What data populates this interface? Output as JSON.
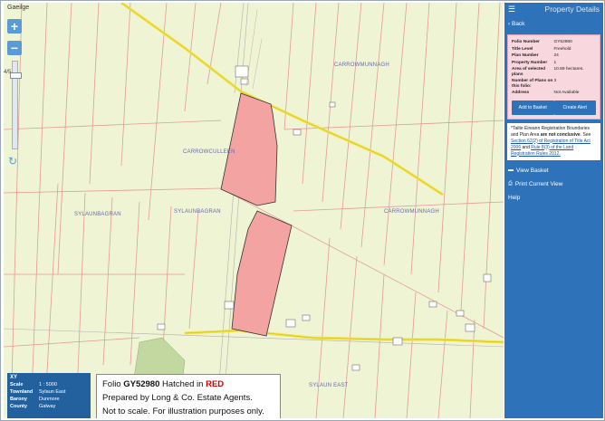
{
  "map": {
    "language_toggle": "Gaeilge",
    "zoom_in": "+",
    "zoom_out": "−",
    "zoom_level_label": "4/5",
    "refresh_icon": "↻",
    "labels": [
      {
        "text": "CARROWMUNNAGH",
        "slot": "a"
      },
      {
        "text": "CARROWCULLEEN",
        "slot": "b"
      },
      {
        "text": "SYLAUNBAGRAN",
        "slot": "c"
      },
      {
        "text": "SYLAUNBAGRAN",
        "slot": "d"
      },
      {
        "text": "CARROWMUNNAGH",
        "slot": "e"
      },
      {
        "text": "SYLAUN EAST",
        "slot": "f"
      }
    ],
    "highlight_color": "#f4a3a3",
    "road_color": "#f2e24a",
    "boundary_color": "#e08080"
  },
  "xy_panel": {
    "title": "XY",
    "rows": [
      {
        "key": "Scale",
        "value": "1 : 5000"
      },
      {
        "key": "Townland",
        "value": "Sylaun East"
      },
      {
        "key": "Barony",
        "value": "Dunmore"
      },
      {
        "key": "County",
        "value": "Galway"
      }
    ]
  },
  "caption": {
    "line1_prefix": "Folio ",
    "folio": "GY52980",
    "line1_middle": " Hatched in ",
    "line1_color_word": "RED",
    "line2": "Prepared by Long & Co. Estate Agents.",
    "line3": "Not to scale. For illustration purposes only."
  },
  "panel": {
    "title": "Property Details",
    "menu_icon": "☰",
    "back_label": "Back",
    "details": [
      {
        "key": "Folio Number",
        "value": "GY52980"
      },
      {
        "key": "Title Level",
        "value": "Freehold"
      },
      {
        "key": "Plan Number",
        "value": "24"
      },
      {
        "key": "Property Number",
        "value": "1"
      },
      {
        "key": "Area of selected plans",
        "value": "10.89 hectares."
      },
      {
        "key": "Number of Plans on this folio:",
        "value": "3"
      },
      {
        "key": "Address",
        "value": "Not Available"
      }
    ],
    "add_to_basket": "Add to Basket",
    "create_alert": "Create Alert",
    "disclaimer_1": "*Tailte Éireann Registration Boundaries and Plan Area ",
    "disclaimer_bold": "are not conclusive",
    "disclaimer_2": ". See ",
    "disclaimer_link1": "Section 62(2) of Registration of Title Act 2006",
    "disclaimer_3": " and ",
    "disclaimer_link2": "Rule 8(3) of the Land Registration Rules 2012.",
    "view_basket": "View Basket",
    "print_view": "Print Current View",
    "help": "Help"
  }
}
